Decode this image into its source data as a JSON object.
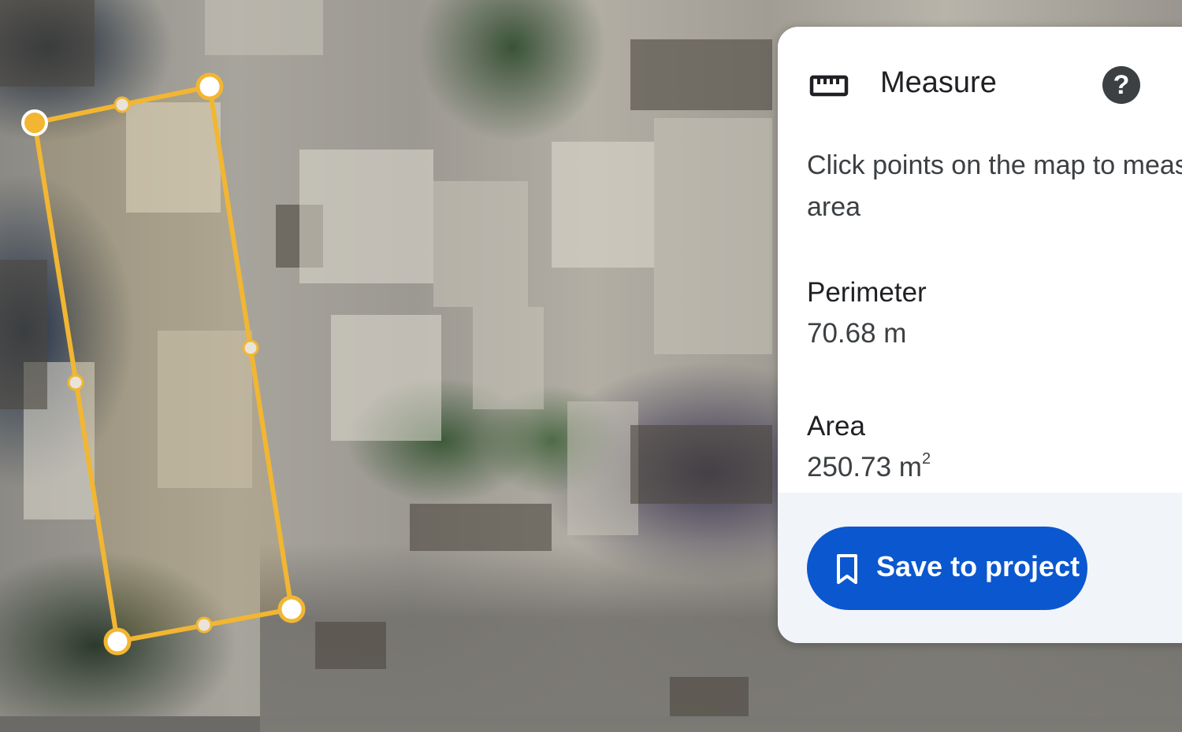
{
  "map": {
    "background": "satellite-imagery",
    "shape_color": "#f2b632"
  },
  "panel": {
    "icon": "ruler-icon",
    "title": "Measure",
    "help_label": "?",
    "instructions_line1": "Click points on the map to measu",
    "instructions_line2": "area",
    "perimeter_label": "Perimeter",
    "perimeter_value": "70.68 m",
    "area_label": "Area",
    "area_value": "250.73 m",
    "area_unit_superscript": "2",
    "save_button_label": "Save to project",
    "save_button_icon": "bookmark-icon",
    "accent_color": "#0b57d0"
  }
}
